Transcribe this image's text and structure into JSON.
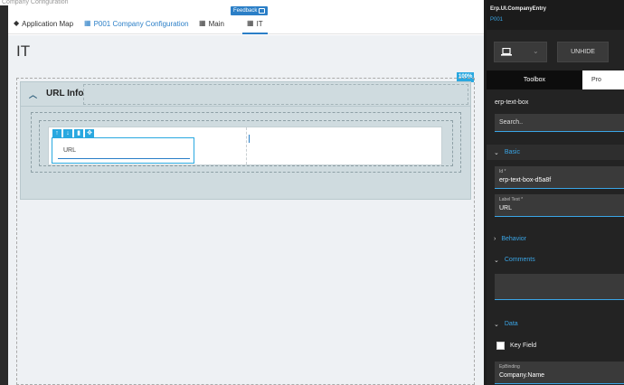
{
  "crumb": "Company Configuration",
  "tabs": {
    "app_map": "Application Map",
    "config": "P001 Company Configuration",
    "main": "Main",
    "it": "IT",
    "feedback": "Feedback"
  },
  "canvas": {
    "page_title": "IT",
    "zoom": "100%",
    "section_title": "URL Info",
    "field_label": "URL"
  },
  "panel": {
    "title": "Erp.UI.CompanyEntry",
    "subtitle": "P001",
    "unhide": "UNHIDE",
    "tab_toolbox": "Toolbox",
    "tab_properties": "Pro",
    "component": "erp-text-box",
    "search_placeholder": "Search..",
    "groups": {
      "basic": "Basic",
      "behavior": "Behavior",
      "comments": "Comments",
      "data": "Data"
    },
    "props": {
      "id_label": "Id *",
      "id_value": "erp-text-box-d5a8f",
      "label_text_label": "Label Text *",
      "label_text_value": "URL",
      "key_field": "Key Field",
      "epbinding_label": "EpBinding",
      "epbinding_value": "Company.Name"
    }
  },
  "colors": {
    "accent": "#2b7fc7",
    "badge": "#29a8e0",
    "section_bg": "#cfdbdf",
    "panel_bg": "#232323"
  }
}
